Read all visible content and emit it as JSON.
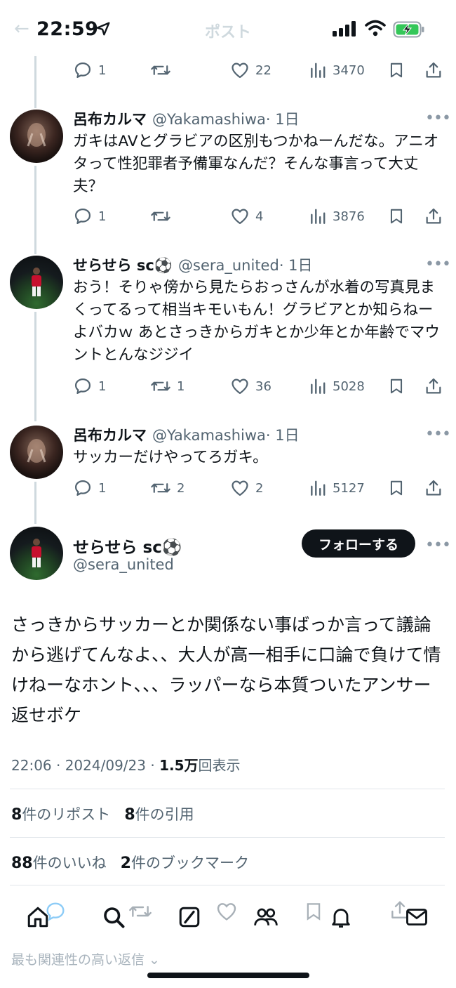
{
  "status": {
    "time": "22:59"
  },
  "header": {
    "title": "ポスト"
  },
  "top_actions": {
    "replies": "1",
    "reposts": "",
    "likes": "22",
    "views": "3470"
  },
  "replies": [
    {
      "name": "呂布カルマ",
      "handle": "@Yakamashiwa",
      "time": "· 1日",
      "text": "ガキはAVとグラビアの区別もつかねーんだな。アニオタって性犯罪者予備軍なんだ？そんな事言って大丈夫？",
      "replies": "1",
      "reposts": "",
      "likes": "4",
      "views": "3876"
    },
    {
      "name": "せらせら sc⚽",
      "handle": "@sera_united",
      "time": "· 1日",
      "text": "おう！そりゃ傍から見たらおっさんが水着の写真見まくってるって相当キモいもん！グラビアとか知らねーよバカｗ あとさっきからガキとか少年とか年齢でマウントとんなジジイ",
      "replies": "1",
      "reposts": "1",
      "likes": "36",
      "views": "5028"
    },
    {
      "name": "呂布カルマ",
      "handle": "@Yakamashiwa",
      "time": "· 1日",
      "text": "サッカーだけやってろガキ。",
      "replies": "1",
      "reposts": "2",
      "likes": "2",
      "views": "5127"
    }
  ],
  "main_post": {
    "name": "せらせら sc⚽",
    "handle": "@sera_united",
    "follow_label": "フォローする",
    "text": "さっきからサッカーとか関係ない事ばっか言って議論から逃げてんなよ、、大人が高一相手に口論で負けて情けねーなホント、、、ラッパーなら本質ついたアンサー返せボケ",
    "timestamp": "22:06 · 2024/09/23 · ",
    "view_count": "1.5万",
    "view_label": "回表示",
    "reposts_count": "8",
    "reposts_label": "件のリポスト",
    "quotes_count": "8",
    "quotes_label": "件の引用",
    "likes_count": "88",
    "likes_label": "件のいいね",
    "bookmarks_count": "2",
    "bookmarks_label": "件のブックマーク"
  },
  "footer": {
    "sort_label": "最も関連性の高い返信"
  },
  "icons": [
    "location-arrow-icon",
    "signal-icon",
    "wifi-icon",
    "battery-charging-icon",
    "reply-icon",
    "repost-icon",
    "like-icon",
    "views-icon",
    "bookmark-icon",
    "share-icon",
    "home-icon",
    "search-icon",
    "grok-icon",
    "communities-icon",
    "notifications-icon",
    "messages-icon"
  ]
}
